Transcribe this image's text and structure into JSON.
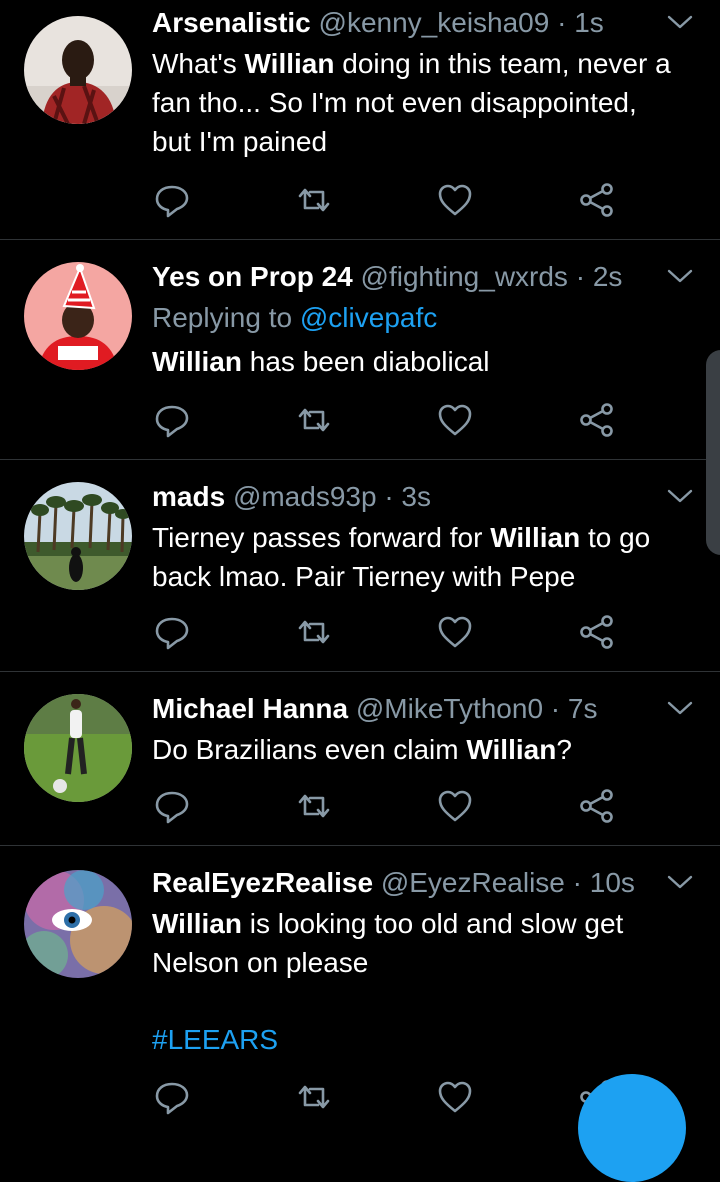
{
  "tweets": [
    {
      "name": "Arsenalistic",
      "handle": "@kenny_keisha09 · 1s",
      "lines": [
        {
          "pre": "What's ",
          "bold": "Willian",
          "post": " doing in this team, never a"
        },
        {
          "pre": "fan tho... So I'm not even disappointed,",
          "bold": "",
          "post": ""
        },
        {
          "pre": "but I'm pained",
          "bold": "",
          "post": ""
        }
      ]
    },
    {
      "name": "Yes on Prop 24",
      "handle": "@fighting_wxrds · 2s",
      "reply_prefix": "Replying to ",
      "reply_handle": "@clivepafc",
      "lines": [
        {
          "pre": "",
          "bold": "Willian",
          "post": " has been diabolical"
        }
      ]
    },
    {
      "name": "mads",
      "handle": "@mads93p · 3s",
      "lines": [
        {
          "pre": "Tierney passes forward for ",
          "bold": "Willian",
          "post": " to go"
        },
        {
          "pre": "back lmao. Pair Tierney with Pepe",
          "bold": "",
          "post": ""
        }
      ]
    },
    {
      "name": "Michael Hanna",
      "handle": "@MikeTython0 · 7s",
      "lines": [
        {
          "pre": "Do Brazilians even claim ",
          "bold": "Willian",
          "post": "?"
        }
      ]
    },
    {
      "name": "RealEyezRealise",
      "handle": "@EyezRealise · 10s",
      "lines": [
        {
          "pre": "",
          "bold": "Willian",
          "post": " is looking too old and slow get"
        },
        {
          "pre": "Nelson on please",
          "bold": "",
          "post": ""
        }
      ],
      "hashtag": "#LEEARS"
    }
  ],
  "icons": {
    "reply": "reply-icon",
    "retweet": "retweet-icon",
    "like": "heart-icon",
    "share": "share-icon",
    "more": "chevron-down-icon"
  },
  "colors": {
    "background": "#000000",
    "text": "#ffffff",
    "muted": "#8899a6",
    "accent": "#1da1f2",
    "divider": "#2f3336"
  }
}
